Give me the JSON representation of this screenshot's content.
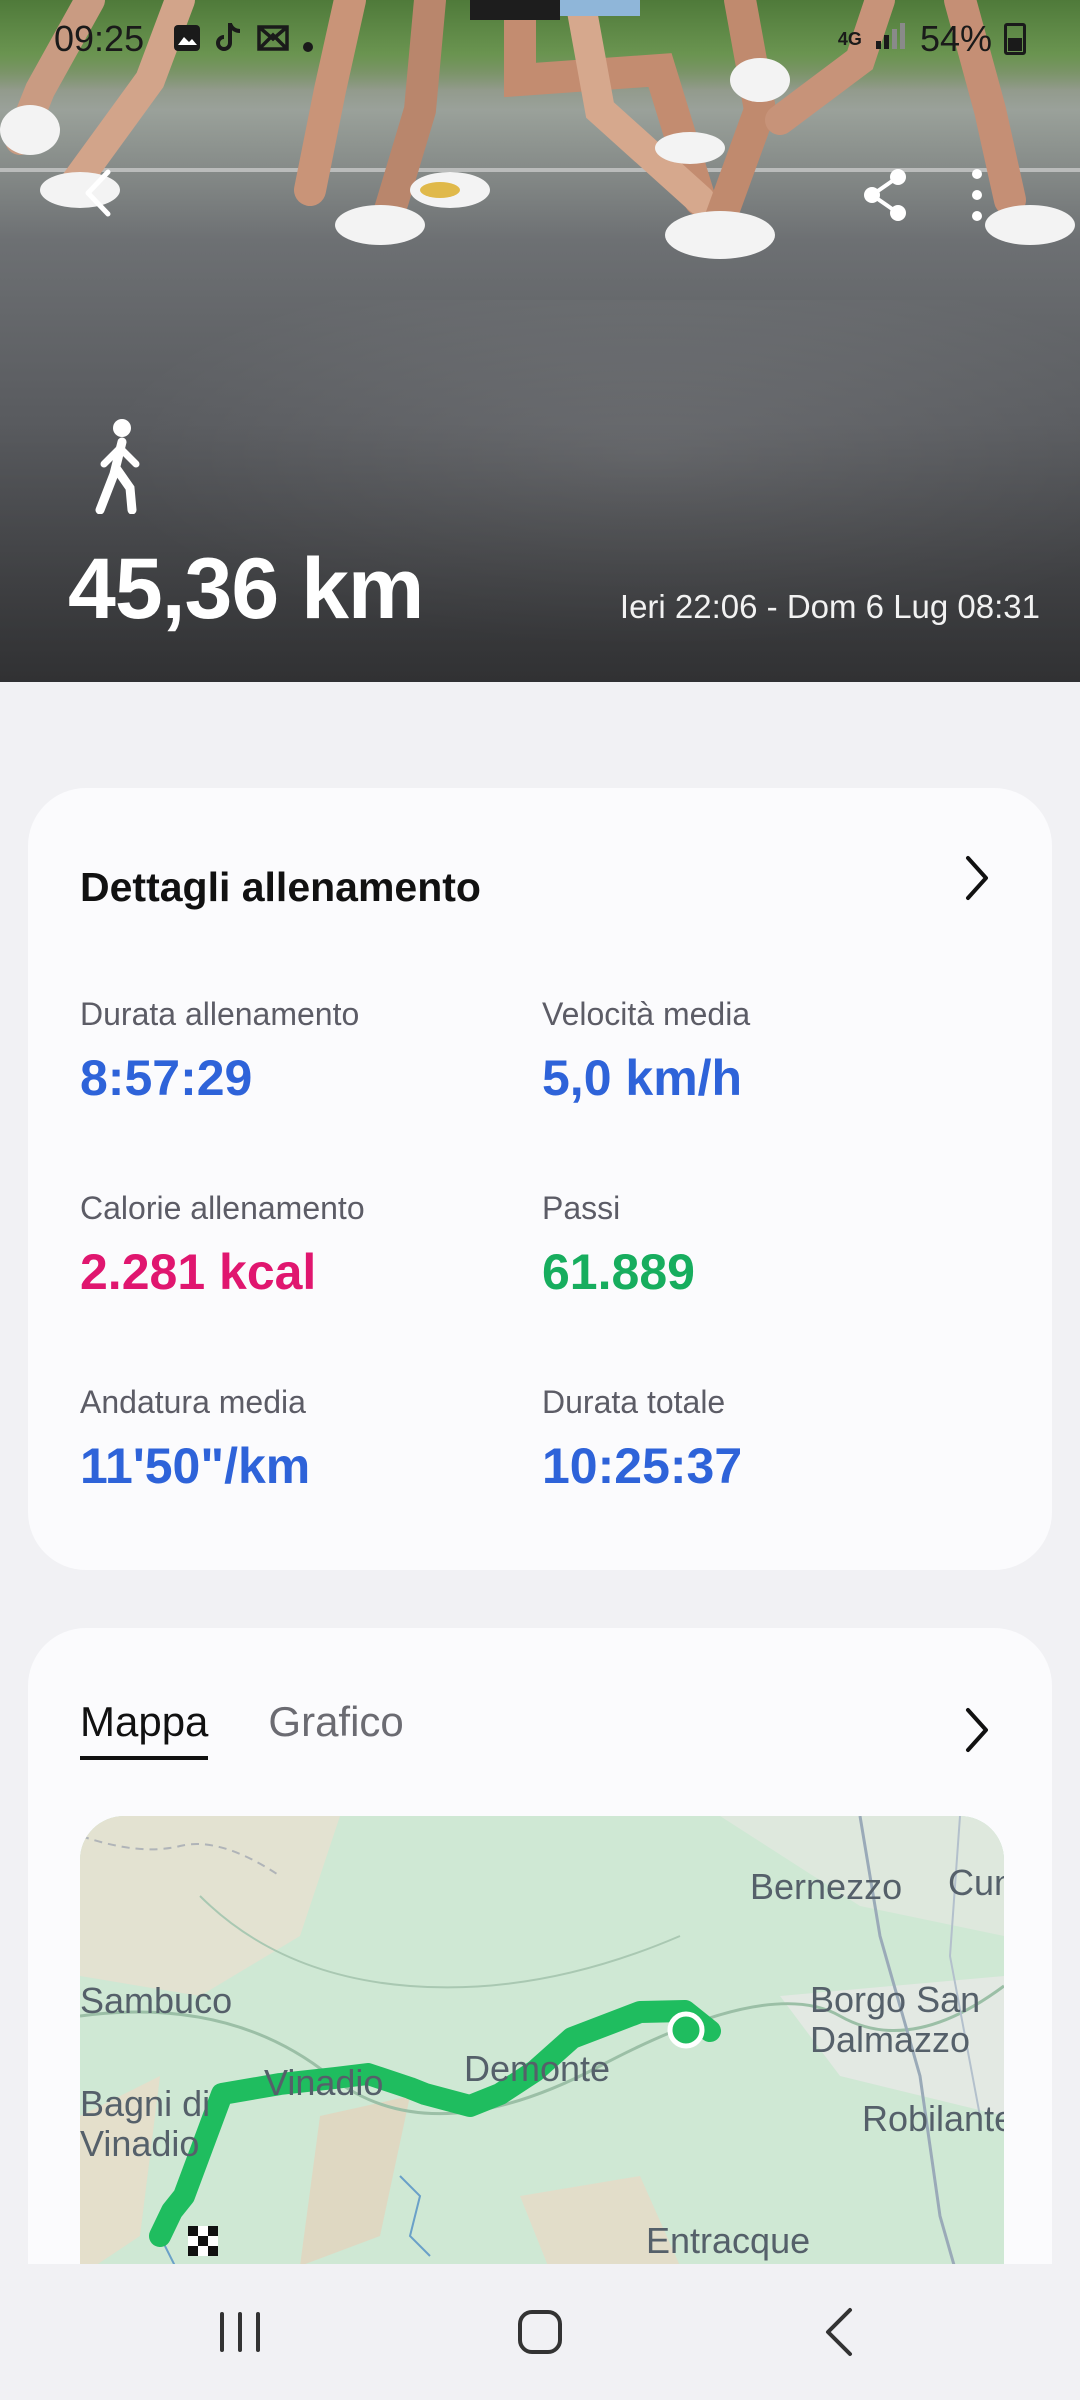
{
  "status_bar": {
    "time": "09:25",
    "network": "4G",
    "battery": "54%"
  },
  "workout": {
    "distance": "45,36 km",
    "date_range": "Ieri 22:06 - Dom 6 Lug 08:31",
    "activity_icon": "walk-icon"
  },
  "details": {
    "title": "Dettagli allenamento",
    "stats": [
      {
        "label": "Durata allenamento",
        "value": "8:57:29",
        "color": "#2e63d9"
      },
      {
        "label": "Velocità media",
        "value": "5,0 km/h",
        "color": "#2e63d9"
      },
      {
        "label": "Calorie allenamento",
        "value": "2.281 kcal",
        "color": "#e0166f"
      },
      {
        "label": "Passi",
        "value": "61.889",
        "color": "#17ad5e"
      },
      {
        "label": "Andatura media",
        "value": "11'50\"/km",
        "color": "#2e63d9"
      },
      {
        "label": "Durata totale",
        "value": "10:25:37",
        "color": "#2e63d9"
      }
    ]
  },
  "map_section": {
    "tabs": [
      "Mappa",
      "Grafico"
    ],
    "active_tab": "Mappa",
    "places": [
      "Bernezzo",
      "Cun",
      "Sambuco",
      "Borgo San Dalmazzo",
      "Bagni di Vinadio",
      "Vinadio",
      "Demonte",
      "Robilante",
      "Entracque"
    ],
    "route_color": "#1fbd5f"
  },
  "colors": {
    "accent_blue": "#2e63d9",
    "calorie_pink": "#e0166f",
    "steps_green": "#17ad5e"
  }
}
